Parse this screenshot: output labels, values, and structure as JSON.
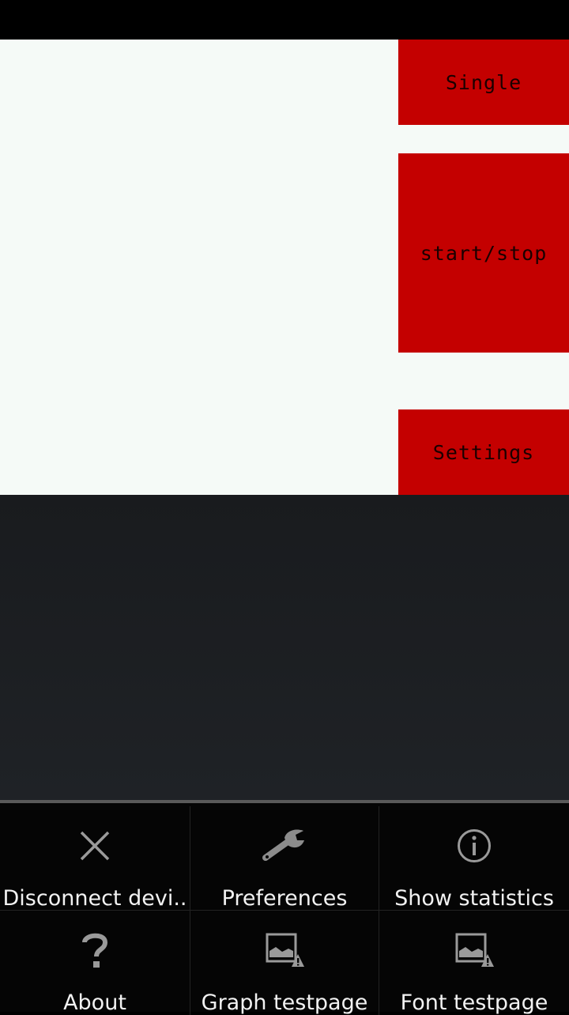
{
  "buttons": {
    "single_label": "Single",
    "start_stop_label": "start/stop",
    "settings_label": "Settings"
  },
  "menu": {
    "items": [
      {
        "label": "Disconnect devi..",
        "icon": "close-icon"
      },
      {
        "label": "Preferences",
        "icon": "wrench-icon"
      },
      {
        "label": "Show statistics",
        "icon": "info-icon"
      },
      {
        "label": "About",
        "icon": "question-icon"
      },
      {
        "label": "Graph testpage",
        "icon": "broken-image-icon"
      },
      {
        "label": "Font testpage",
        "icon": "broken-image-icon"
      }
    ]
  },
  "colors": {
    "accent_red": "#c40000",
    "content_bg": "#f5faf7",
    "menu_bg": "#050505"
  }
}
